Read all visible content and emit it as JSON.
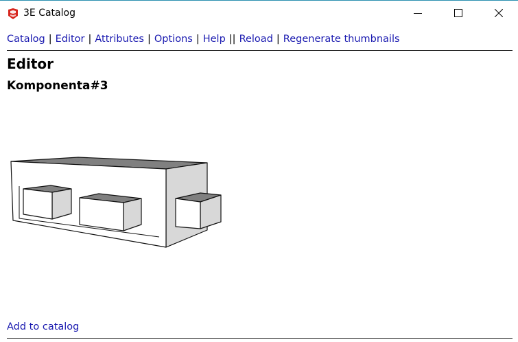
{
  "window": {
    "title": "3E Catalog",
    "icon": "sketchup-logo-icon"
  },
  "menu": {
    "items": [
      "Catalog",
      "Editor",
      "Attributes",
      "Options",
      "Help",
      "Reload",
      "Regenerate thumbnails"
    ],
    "separator": "|",
    "double_separator": "||"
  },
  "page": {
    "heading": "Editor",
    "component_name": "Komponenta#3",
    "add_link": "Add to catalog"
  },
  "colors": {
    "link": "#1a1ab0",
    "top_face": "#808080",
    "side_face": "#d8d8d8",
    "front_face": "#ffffff",
    "outline": "#111111"
  }
}
